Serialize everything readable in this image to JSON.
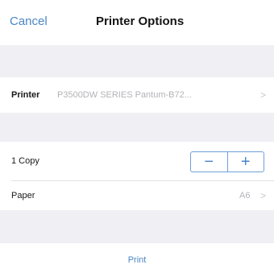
{
  "navbar": {
    "cancel_label": "Cancel",
    "title": "Printer Options"
  },
  "printer": {
    "label": "Printer",
    "value": "P3500DW SERIES Pantum-B72...",
    "chevron": ">"
  },
  "copies": {
    "label": "1 Copy",
    "minus": "−",
    "plus": "+"
  },
  "paper": {
    "label": "Paper",
    "value": "A6",
    "chevron": ">"
  },
  "print": {
    "label": "Print"
  },
  "colors": {
    "accent": "#4a86c6",
    "background_grey": "#efeff4",
    "secondary_text": "#b3b3b8"
  }
}
